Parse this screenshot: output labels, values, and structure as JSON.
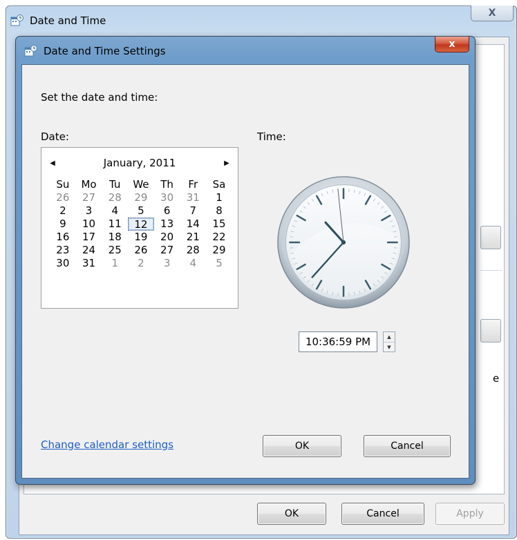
{
  "outer_window": {
    "title": "Date and Time",
    "close_glyph": "X",
    "buttons": {
      "ok": "OK",
      "cancel": "Cancel",
      "apply": "Apply"
    },
    "obscured_char": "e"
  },
  "dialog": {
    "title": "Date and Time Settings",
    "close_glyph": "x",
    "heading": "Set the date and time:",
    "date_label": "Date:",
    "time_label": "Time:",
    "calendar": {
      "prev_glyph": "◀",
      "next_glyph": "▶",
      "month_year": "January, 2011",
      "weekdays": [
        "Su",
        "Mo",
        "Tu",
        "We",
        "Th",
        "Fr",
        "Sa"
      ],
      "weeks": [
        [
          {
            "d": "26",
            "dim": true
          },
          {
            "d": "27",
            "dim": true
          },
          {
            "d": "28",
            "dim": true
          },
          {
            "d": "29",
            "dim": true
          },
          {
            "d": "30",
            "dim": true
          },
          {
            "d": "31",
            "dim": true
          },
          {
            "d": "1"
          }
        ],
        [
          {
            "d": "2"
          },
          {
            "d": "3"
          },
          {
            "d": "4"
          },
          {
            "d": "5"
          },
          {
            "d": "6"
          },
          {
            "d": "7"
          },
          {
            "d": "8"
          }
        ],
        [
          {
            "d": "9"
          },
          {
            "d": "10"
          },
          {
            "d": "11"
          },
          {
            "d": "12",
            "selected": true
          },
          {
            "d": "13"
          },
          {
            "d": "14"
          },
          {
            "d": "15"
          }
        ],
        [
          {
            "d": "16"
          },
          {
            "d": "17"
          },
          {
            "d": "18"
          },
          {
            "d": "19"
          },
          {
            "d": "20"
          },
          {
            "d": "21"
          },
          {
            "d": "22"
          }
        ],
        [
          {
            "d": "23"
          },
          {
            "d": "24"
          },
          {
            "d": "25"
          },
          {
            "d": "26"
          },
          {
            "d": "27"
          },
          {
            "d": "28"
          },
          {
            "d": "29"
          }
        ],
        [
          {
            "d": "30"
          },
          {
            "d": "31"
          },
          {
            "d": "1",
            "dim": true
          },
          {
            "d": "2",
            "dim": true
          },
          {
            "d": "3",
            "dim": true
          },
          {
            "d": "4",
            "dim": true
          },
          {
            "d": "5",
            "dim": true
          }
        ]
      ]
    },
    "clock": {
      "hour": 10,
      "minute": 36,
      "second": 59
    },
    "time_value": "10:36:59 PM",
    "spin_up": "▲",
    "spin_down": "▼",
    "change_calendar_link": "Change calendar settings",
    "ok_label": "OK",
    "cancel_label": "Cancel"
  },
  "colors": {
    "link": "#1f5ec6",
    "dialog_frame": "#6f9dcb",
    "close_red": "#c0361c",
    "hand": "#2f4f5c",
    "tick": "#3d5f6b"
  }
}
